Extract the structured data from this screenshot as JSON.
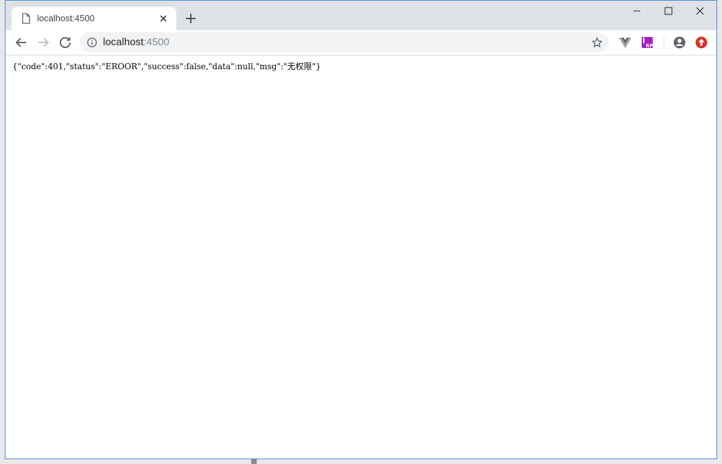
{
  "tab": {
    "title": "localhost:4500",
    "favicon": "page-icon"
  },
  "window_controls": [
    "minimize-icon",
    "maximize-icon",
    "close-icon"
  ],
  "toolbar": {
    "url_host": "localhost",
    "url_port": ":4500",
    "icons": [
      "back-icon",
      "forward-icon",
      "reload-icon",
      "info-icon",
      "star-icon",
      "vue-devtools-icon",
      "rp-extension-icon",
      "profile-icon",
      "update-icon"
    ]
  },
  "page": {
    "json_text": "{\"code\":401,\"status\":\"EROOR\",\"success\":false,\"data\":null,\"msg\":\"无权限\"}"
  },
  "colors": {
    "tabstrip": "#dee1e6",
    "omnibox": "#f1f3f4",
    "window_border": "#4a8bd6",
    "update_red": "#d93025",
    "rp_purple": "#a51fc2"
  }
}
